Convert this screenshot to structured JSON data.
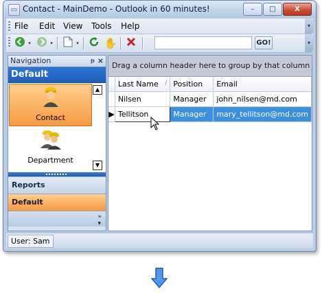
{
  "window": {
    "title": "Contact - MainDemo - Outlook in 60 minutes!",
    "minimize": "–",
    "maximize": "□",
    "close": "X"
  },
  "menu": {
    "items": [
      "File",
      "Edit",
      "View",
      "Tools",
      "Help"
    ]
  },
  "toolbar": {
    "search_value": "",
    "go_label": "GO!",
    "icons": [
      "back-icon",
      "forward-icon",
      "new-document-icon",
      "refresh-icon",
      "hand-icon",
      "delete-icon"
    ]
  },
  "navigation": {
    "header": "Navigation",
    "pin_glyph": "ᵽ",
    "close_glyph": "×",
    "group_title": "Default",
    "items": [
      {
        "label": "Contact",
        "icon": "contact-icon",
        "selected": true
      },
      {
        "label": "Department",
        "icon": "department-icon",
        "selected": false
      }
    ],
    "sections": [
      {
        "label": "Reports",
        "active": false
      },
      {
        "label": "Default",
        "active": true
      }
    ]
  },
  "grid": {
    "group_panel_text": "Drag a column header here to group by that column",
    "columns": [
      "Last Name",
      "Position",
      "Email"
    ],
    "rows": [
      {
        "last_name": "Nilsen",
        "position": "Manager",
        "email": "john_nilsen@md.com",
        "selected": false
      },
      {
        "last_name": "Tellitson",
        "position": "Manager",
        "email": "mary_tellitson@md.com",
        "selected": true
      }
    ]
  },
  "status": {
    "user_text": "User: Sam"
  },
  "colors": {
    "accent_blue": "#1d5fba",
    "selected_orange": "#f79a43",
    "row_selection": "#3c8fe0",
    "delete_red": "#d02020"
  }
}
